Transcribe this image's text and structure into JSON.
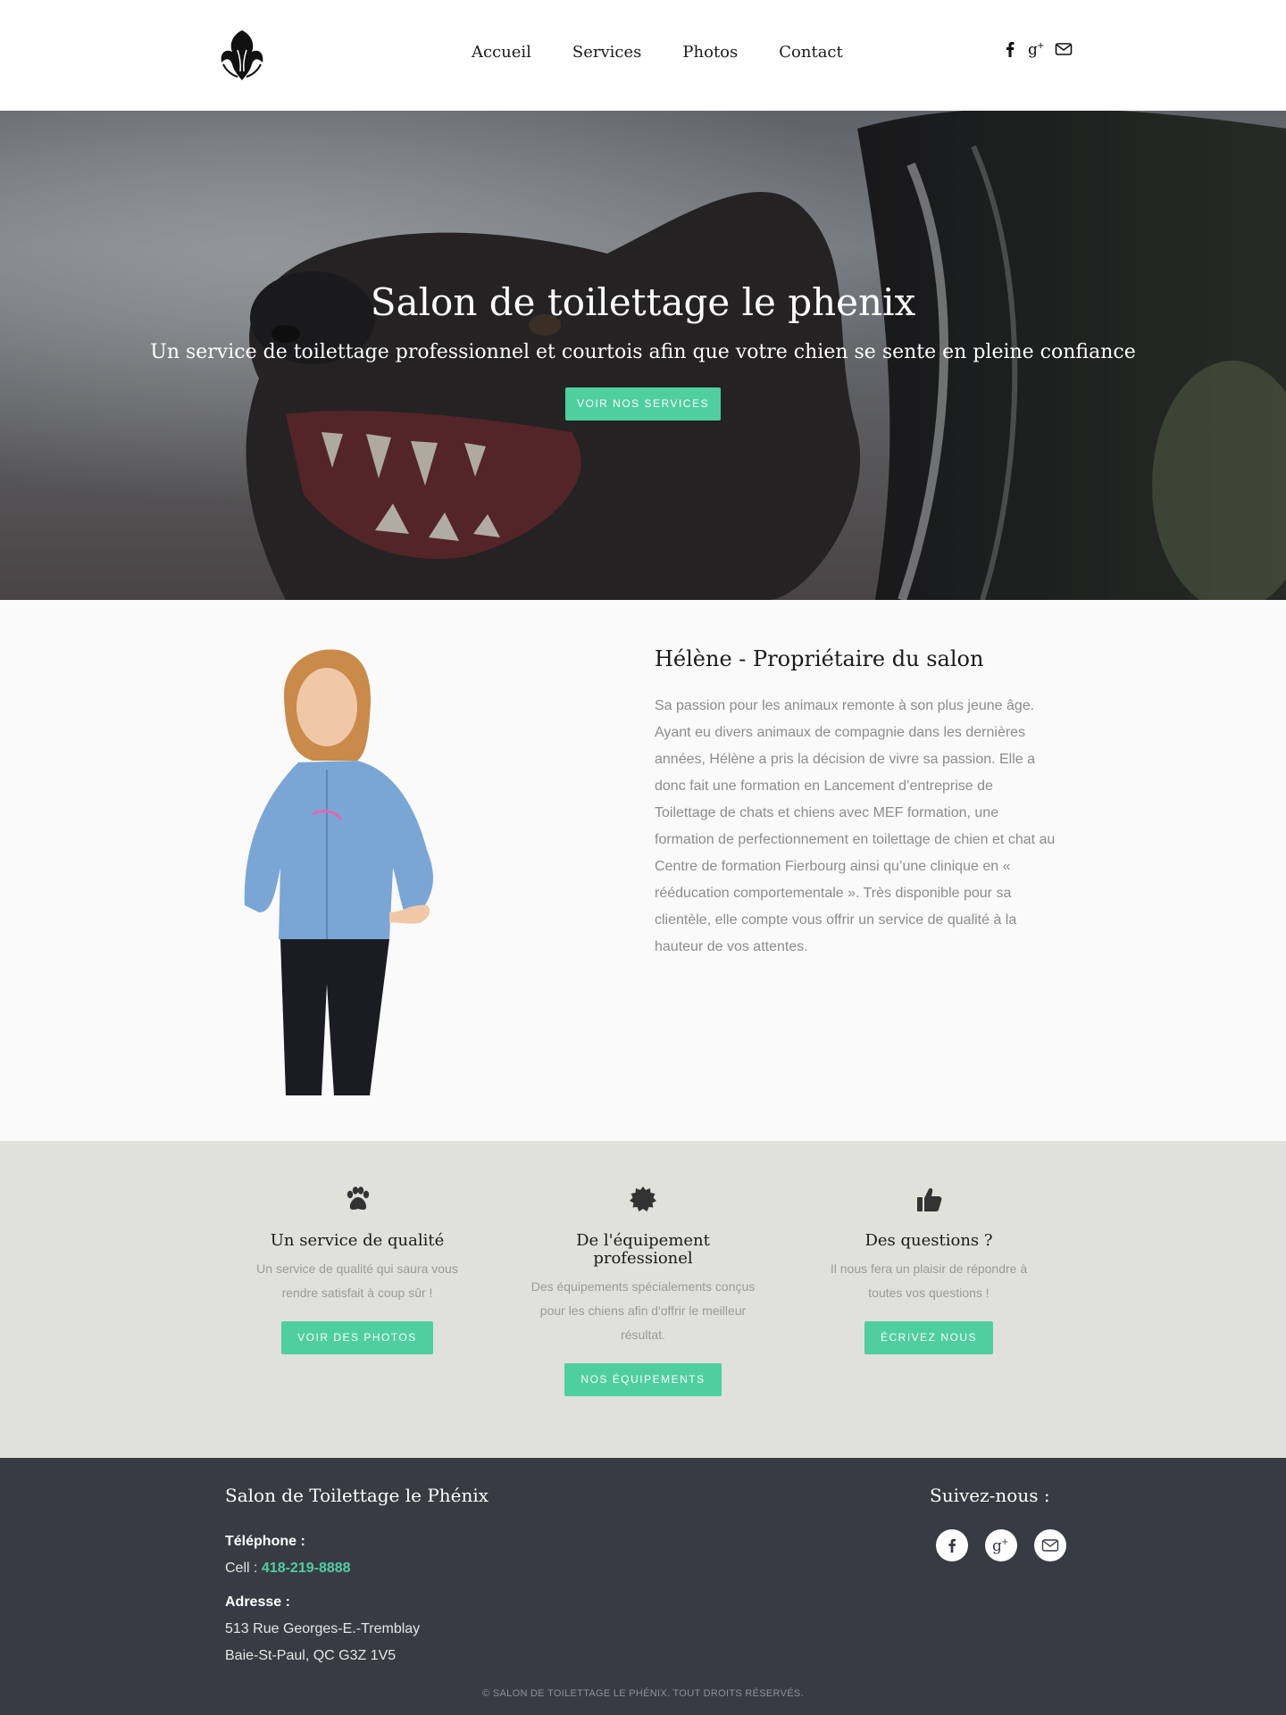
{
  "nav": {
    "links": [
      "Accueil",
      "Services",
      "Photos",
      "Contact"
    ],
    "social_icons": [
      "facebook-icon",
      "google-plus-icon",
      "mail-icon"
    ]
  },
  "hero": {
    "title": "Salon de toilettage le phenix",
    "subtitle": "Un service de toilettage professionnel et courtois afin que votre chien se sente en pleine confiance",
    "button": "Voir nos services"
  },
  "owner": {
    "heading": "Hélène - Propriétaire du salon",
    "bio": "Sa passion pour les animaux remonte à son plus jeune âge. Ayant eu divers animaux de compagnie dans les dernières années, Hélène a pris la décision de vivre sa passion. Elle a donc fait une formation en Lancement d’entreprise de Toilettage de chats et chiens avec MEF formation, une formation de perfectionnement en toilettage de chien et chat au Centre de formation Fierbourg ainsi qu’une clinique en « rééducation comportementale ». Très disponible pour sa clientèle, elle compte vous offrir un service de qualité à la hauteur de vos attentes."
  },
  "features": [
    {
      "icon": "paw-icon",
      "title": "Un service de qualité",
      "text": "Un service de qualité qui saura vous rendre satisfait à coup sûr !",
      "button": "Voir des photos"
    },
    {
      "icon": "badge-icon",
      "title": "De l'équipement professionel",
      "text": "Des équipements spécialements conçus pour les chiens afin d'offrir le meilleur résultat.",
      "button": "Nos équipements"
    },
    {
      "icon": "thumbs-up-icon",
      "title": "Des questions ?",
      "text": "Il nous fera un plaisir de répondre à toutes vos questions !",
      "button": "Écrivez nous"
    }
  ],
  "footer": {
    "brand": "Salon de Toilettage le Phénix",
    "phone_label": "Téléphone :",
    "cell_prefix": "Cell : ",
    "phone": "418-219-8888",
    "address_label": "Adresse :",
    "address_line1": "513 Rue Georges-E.-Tremblay",
    "address_line2": "Baie-St-Paul, QC G3Z 1V5",
    "follow": "Suivez-nous :",
    "copyright": "© SALON DE TOILETTAGE LE PHÉNIX. TOUT DROITS RÉSERVÉS."
  },
  "colors": {
    "accent": "#4fcf9f",
    "footer_bg": "#383b44",
    "features_bg": "#e1e1dc"
  }
}
